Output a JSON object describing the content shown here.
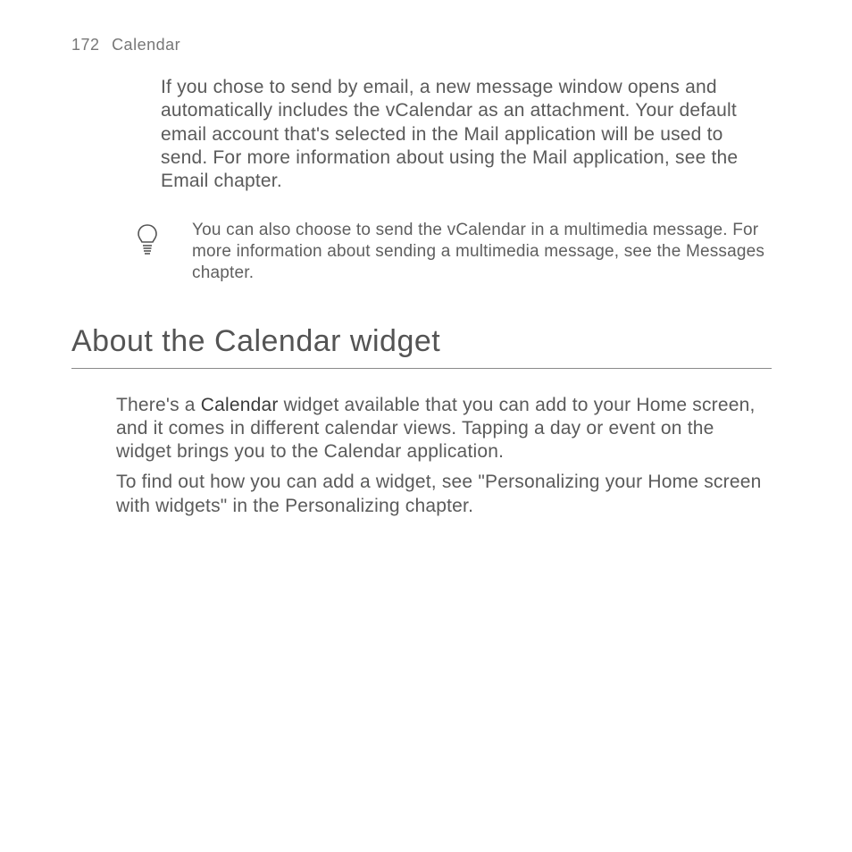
{
  "header": {
    "page_number": "172",
    "title": "Calendar"
  },
  "intro_para": "If you chose to send by email, a new message window opens and automatically includes the vCalendar as an attachment. Your default email account that's selected in the Mail application will be used to send. For more information about using the Mail application, see the Email chapter.",
  "tip": {
    "icon": "lightbulb-tip-icon",
    "text": "You can also choose to send the vCalendar in a multimedia message. For more information about sending a multimedia message, see the Messages chapter."
  },
  "section": {
    "heading": "About the Calendar widget",
    "para1_prefix": "There's a ",
    "para1_keyword": "Calendar",
    "para1_suffix": " widget available that you can add to your Home screen, and it comes in different calendar views. Tapping a day or event on the widget brings you to the Calendar application.",
    "para2": "To find out how you can add a widget, see \"Personalizing your Home screen with widgets\" in the Personalizing chapter."
  }
}
